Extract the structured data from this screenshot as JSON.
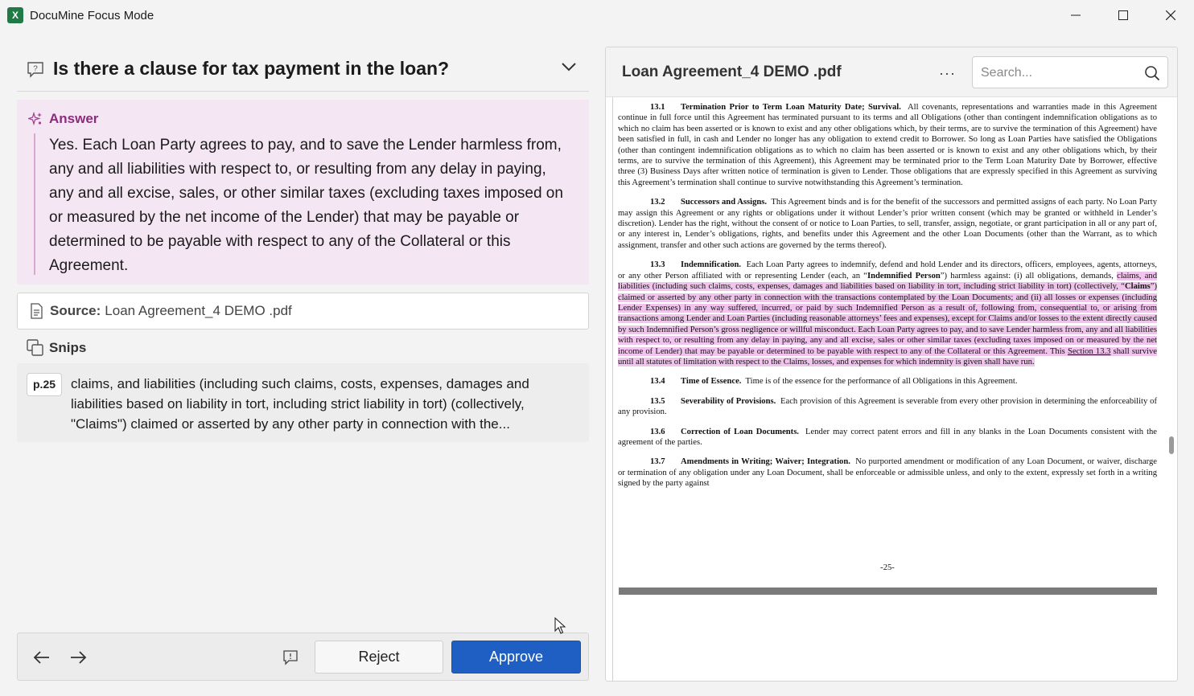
{
  "window": {
    "title": "DocuMine Focus Mode",
    "app_icon_letter": "X",
    "controls": [
      "minimize",
      "maximize",
      "close"
    ]
  },
  "question": {
    "text": "Is there a clause for tax payment in the loan?"
  },
  "answer": {
    "label": "Answer",
    "text": "Yes. Each Loan Party agrees to pay, and to save the Lender harmless from, any and all liabilities with respect to, or resulting from any delay in paying, any and all excise, sales, or other similar taxes (excluding taxes imposed on or measured by the net income of the Lender) that may be payable or determined to be payable with respect to any of the Collateral or this Agreement."
  },
  "source": {
    "label": "Source:",
    "value": "Loan Agreement_4 DEMO .pdf"
  },
  "snips": {
    "label": "Snips",
    "items": [
      {
        "page": "p.25",
        "text": "claims, and liabilities (including such claims, costs, expenses, damages and liabilities based on liability in tort, including strict liability in tort) (collectively, \"Claims\") claimed or asserted by any other party in connection with the..."
      }
    ]
  },
  "footer": {
    "reject_label": "Reject",
    "approve_label": "Approve"
  },
  "document": {
    "title": "Loan Agreement_4 DEMO .pdf",
    "more_label": "···",
    "search_placeholder": "Search...",
    "page_number": "-25-",
    "sections": {
      "s131": {
        "num": "13.1",
        "heading": "Termination Prior to Term Loan Maturity Date; Survival.",
        "body": "All covenants, representations and warranties made in this Agreement continue in full force until this Agreement has terminated pursuant to its terms and all Obligations (other than contingent indemnification obligations as to which no claim has been asserted or is known to exist and any other obligations which, by their terms, are to survive the termination of this Agreement) have been satisfied in full, in cash and Lender no longer has any obligation to extend credit to Borrower. So long as Loan Parties have satisfied the Obligations (other than contingent indemnification obligations as to which no claim has been asserted or is known to exist and any other obligations which, by their terms, are to survive the termination of this Agreement), this Agreement may be terminated prior to the Term Loan Maturity Date by Borrower, effective three (3) Business Days after written notice of termination is given to Lender. Those obligations that are expressly specified in this Agreement as surviving this Agreement’s termination shall continue to survive notwithstanding this Agreement’s termination."
      },
      "s132": {
        "num": "13.2",
        "heading": "Successors and Assigns.",
        "body": "This Agreement binds and is for the benefit of the successors and permitted assigns of each party. No Loan Party may assign this Agreement or any rights or obligations under it without Lender’s prior written consent (which may be granted or withheld in Lender’s discretion). Lender has the right, without the consent of or notice to Loan Parties, to sell, transfer, assign, negotiate, or grant participation in all or any part of, or any interest in, Lender’s obligations, rights, and benefits under this Agreement and the other Loan Documents (other than the Warrant, as to which assignment, transfer and other such actions are governed by the terms thereof)."
      },
      "s133": {
        "num": "13.3",
        "heading": "Indemnification.",
        "body_a": "Each Loan Party agrees to indemnify, defend and hold Lender and its directors, officers, employees, agents, attorneys, or any other Person affiliated with or representing Lender (each, an “",
        "defined_term": "Indemnified Person",
        "body_b": "”) harmless against: (i) all obligations, demands,",
        "highlight_a": "claims, and liabilities (including such claims, costs, expenses, damages and liabilities based on liability in tort, including strict liability in tort) (collectively, “",
        "claims_term": "Claims",
        "highlight_b": "”) claimed or asserted by any other party in connection with the transactions contemplated by the Loan Documents; and (ii) all losses or expenses (including Lender Expenses) in any way suffered, incurred, or paid by such Indemnified Person as a result of, following from, consequential to, or arising from transactions among Lender and Loan Parties (including reasonable attorneys’ fees and expenses), except for Claims and/or losses to the extent directly caused by such Indemnified Person’s gross negligence or willful misconduct. Each Loan Party agrees to pay, and to save Lender harmless from, any and all liabilities with respect to, or resulting from any delay in paying, any and all excise, sales or other similar taxes (excluding taxes imposed on or measured by the net income of Lender) that may be payable or determined to be payable with respect to any of the Collateral or this Agreement. This ",
        "section_link": "Section 13.3",
        "highlight_c": " shall survive until all statutes of limitation with respect to the Claims, losses, and expenses for which indemnity is given shall have run."
      },
      "s134": {
        "num": "13.4",
        "heading": "Time of Essence.",
        "body": "Time is of the essence for the performance of all Obligations in this Agreement."
      },
      "s135": {
        "num": "13.5",
        "heading": "Severability of Provisions.",
        "body": "Each provision of this Agreement is severable from every other provision in determining the enforceability of any provision."
      },
      "s136": {
        "num": "13.6",
        "heading": "Correction of Loan Documents.",
        "body": "Lender may correct patent errors and fill in any blanks in the Loan Documents consistent with the agreement of the parties."
      },
      "s137": {
        "num": "13.7",
        "heading": "Amendments in Writing; Waiver; Integration.",
        "body": "No purported amendment or modification of any Loan Document, or waiver, discharge or termination of any obligation under any Loan Document, shall be enforceable or admissible unless, and only to the extent, expressly set forth in a writing signed by the party against"
      }
    }
  },
  "colors": {
    "answer_bg": "#f4e6f2",
    "answer_accent": "#8a2d7c",
    "highlight": "#f0c4ec",
    "approve": "#1f5fc4"
  }
}
